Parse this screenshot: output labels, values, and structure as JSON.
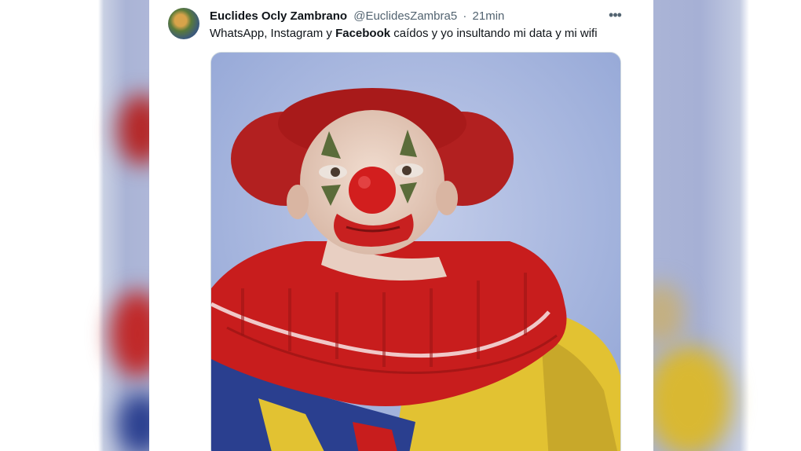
{
  "tweet": {
    "author_name": "Euclides Ocly Zambrano",
    "handle": "@EuclidesZambra5",
    "separator": "·",
    "time": "21min",
    "more_label": "•••",
    "text_before": "WhatsApp, Instagram y ",
    "text_bold": "Facebook",
    "text_after": " caídos y yo insultando mi data y mi wifi",
    "image_icon": "clown-portrait-image"
  },
  "colors": {
    "text_primary": "#0f1419",
    "text_secondary": "#536471",
    "clown_red": "#c81d1d",
    "clown_yellow": "#e8c934",
    "clown_blue": "#2a3f8f",
    "backdrop": "#a9b6dd"
  }
}
